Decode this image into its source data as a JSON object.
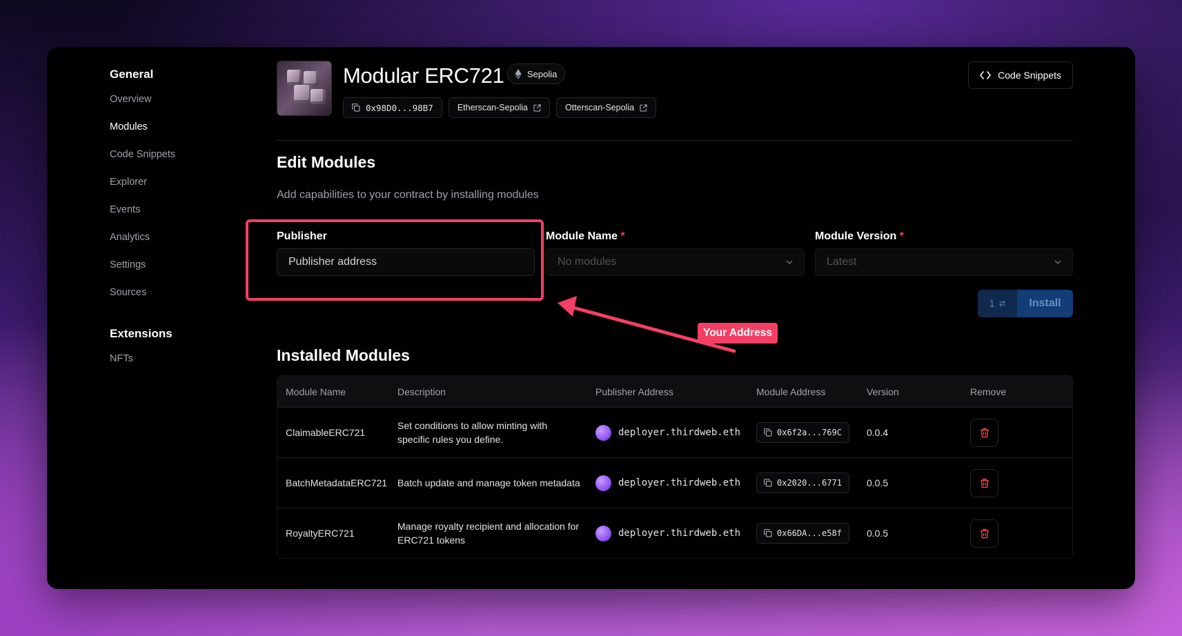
{
  "sidebar": {
    "general_heading": "General",
    "general_items": [
      {
        "label": "Overview",
        "active": false
      },
      {
        "label": "Modules",
        "active": true
      },
      {
        "label": "Code Snippets",
        "active": false
      },
      {
        "label": "Explorer",
        "active": false
      },
      {
        "label": "Events",
        "active": false
      },
      {
        "label": "Analytics",
        "active": false
      },
      {
        "label": "Settings",
        "active": false
      },
      {
        "label": "Sources",
        "active": false
      }
    ],
    "extensions_heading": "Extensions",
    "extension_items": [
      {
        "label": "NFTs"
      }
    ]
  },
  "header": {
    "title": "Modular ERC721",
    "chain": "Sepolia",
    "address": "0x98D0...98B7",
    "explorer_links": [
      "Etherscan-Sepolia",
      "Otterscan-Sepolia"
    ],
    "code_snippets_label": "Code Snippets"
  },
  "edit": {
    "title": "Edit Modules",
    "subtitle": "Add capabilities to your contract by installing modules",
    "publisher_label": "Publisher",
    "publisher_placeholder": "Publisher address",
    "module_name_label": "Module Name",
    "module_name_value": "No modules",
    "module_version_label": "Module Version",
    "module_version_value": "Latest",
    "required_mark": "*",
    "install_count": "1",
    "install_label": "Install"
  },
  "annotation": {
    "tag": "Your Address",
    "color": "#f43f64"
  },
  "installed": {
    "title": "Installed Modules",
    "columns": [
      "Module Name",
      "Description",
      "Publisher Address",
      "Module Address",
      "Version",
      "Remove"
    ],
    "rows": [
      {
        "name": "ClaimableERC721",
        "description": "Set conditions to allow minting with specific rules you define.",
        "publisher": "deployer.thirdweb.eth",
        "address": "0x6f2a...769C",
        "version": "0.0.4"
      },
      {
        "name": "BatchMetadataERC721",
        "description": "Batch update and manage token metadata",
        "publisher": "deployer.thirdweb.eth",
        "address": "0x2020...6771",
        "version": "0.0.5"
      },
      {
        "name": "RoyaltyERC721",
        "description": "Manage royalty recipient and allocation for ERC721 tokens",
        "publisher": "deployer.thirdweb.eth",
        "address": "0x66DA...e58f",
        "version": "0.0.5"
      }
    ]
  },
  "icons": {
    "copy": "copy-icon",
    "external": "external-link-icon",
    "ethereum": "ethereum-icon",
    "code": "code-icon",
    "chevron": "chevron-down-icon",
    "trash": "trash-icon",
    "swap": "swap-icon"
  }
}
